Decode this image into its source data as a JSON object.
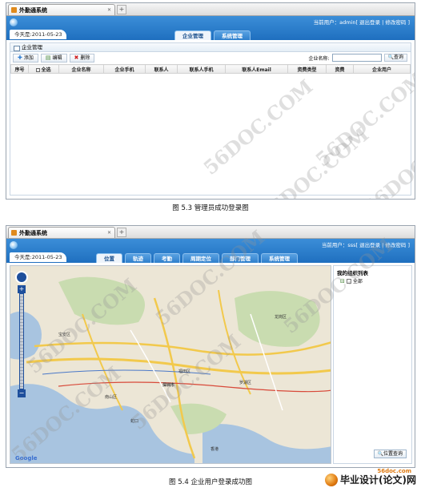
{
  "screenshot1": {
    "tab_title": "外勤通系统",
    "user_text": "当前用户：admin[ 退出登录 | 修改密码 ]",
    "date_text": "今天是:2011-05-23",
    "nav_tabs": [
      "企业管理",
      "系统管理"
    ],
    "active_tab": 0,
    "panel_title": "企业管理",
    "toolbar": {
      "add": "添加",
      "edit": "编辑",
      "delete": "删除"
    },
    "search_label": "企业名称:",
    "search_button": "查询",
    "columns": [
      "序号",
      "全选",
      "企业名称",
      "企业手机",
      "联系人",
      "联系人手机",
      "联系人Email",
      "资费类型",
      "资费",
      "企业用户"
    ]
  },
  "caption1": "图 5.3 管理员成功登录图",
  "screenshot2": {
    "tab_title": "外勤通系统",
    "user_text": "当前用户：sss[ 退出登录 | 修改密码 ]",
    "date_text": "今天是:2011-05-23",
    "nav_tabs": [
      "位置",
      "轨迹",
      "考勤",
      "周期定位",
      "部门管理",
      "系统管理"
    ],
    "active_tab": 0,
    "side_title": "我的组织列表",
    "side_item": "全部",
    "locate_button": "位置查询",
    "map_labels": [
      "深圳市",
      "罗湖区",
      "蛇口",
      "香港",
      "南山区",
      "福田区",
      "宝安区",
      "龙岗区",
      "Google"
    ]
  },
  "caption2": "图 5.4 企业用户登录成功图",
  "watermark_text": "56DOC.COM",
  "footer": {
    "site": "56doc.com",
    "brand": "毕业设计(论文)网"
  }
}
